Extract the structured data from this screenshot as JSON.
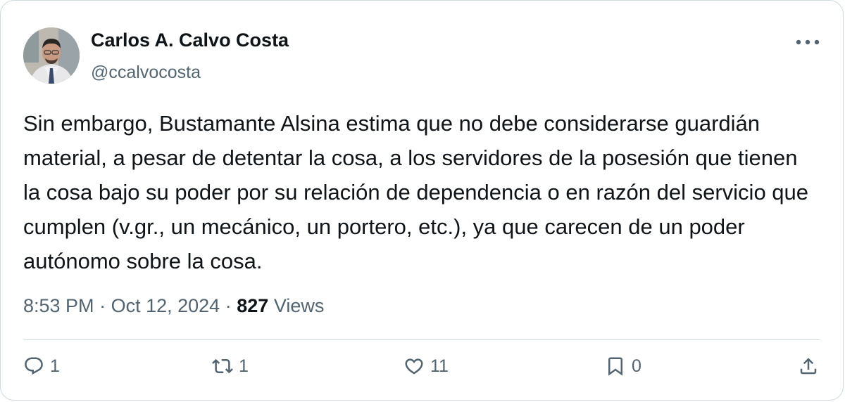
{
  "author": {
    "name": "Carlos A. Calvo Costa",
    "handle": "@ccalvocosta"
  },
  "tweet": {
    "text": "Sin embargo, Bustamante Alsina estima que no debe considerarse guardián material, a pesar de detentar la cosa, a los servidores de la posesión que tienen la cosa bajo su poder por su relación de dependencia o en razón del servicio que cumplen (v.gr., un mecánico, un portero, etc.), ya que carecen de un poder autónomo sobre la cosa.",
    "time": "8:53 PM",
    "separator": "·",
    "date": "Oct 12, 2024",
    "views_count": "827",
    "views_label": "Views"
  },
  "actions": {
    "replies": "1",
    "retweets": "1",
    "likes": "11",
    "bookmarks": "0"
  },
  "icons": {
    "more": "more-icon",
    "reply": "reply-icon",
    "retweet": "retweet-icon",
    "like": "heart-icon",
    "bookmark": "bookmark-icon",
    "share": "share-icon"
  },
  "colors": {
    "text": "#0f1419",
    "secondary": "#536471",
    "border": "#cfd9de"
  }
}
